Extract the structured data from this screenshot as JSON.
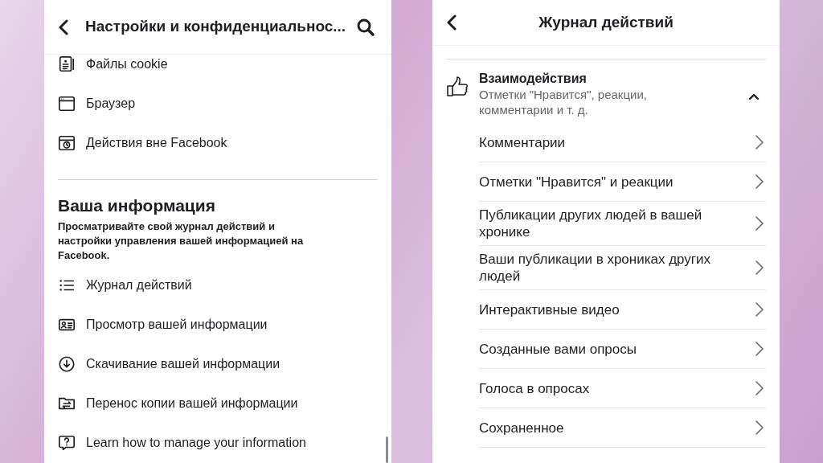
{
  "settings_panel": {
    "title": "Настройки и конфиденциальнос...",
    "items": [
      {
        "label": "Файлы cookie"
      },
      {
        "label": "Браузер"
      },
      {
        "label": "Действия вне Facebook"
      }
    ],
    "section": {
      "heading": "Ваша информация",
      "description": "Просматривайте свой журнал действий и настройки управления вашей информацией на Facebook."
    },
    "section_items": [
      {
        "label": "Журнал действий"
      },
      {
        "label": "Просмотр вашей информации"
      },
      {
        "label": "Скачивание вашей информации"
      },
      {
        "label": "Перенос копии вашей информации"
      },
      {
        "label": "Learn how to manage your information"
      }
    ]
  },
  "activity_panel": {
    "title": "Журнал действий",
    "category": {
      "title": "Взаимодействия",
      "subtitle": "Отметки \"Нравится\", реакции, комментарии и т. д.",
      "expanded": true
    },
    "items": [
      {
        "label": "Комментарии"
      },
      {
        "label": "Отметки \"Нравится\" и реакции"
      },
      {
        "label": "Публикации других людей в вашей хронике"
      },
      {
        "label": "Ваши публикации в хрониках других людей"
      },
      {
        "label": "Интерактивные видео"
      },
      {
        "label": "Созданные вами опросы"
      },
      {
        "label": "Голоса в опросах"
      },
      {
        "label": "Сохраненное"
      }
    ]
  }
}
